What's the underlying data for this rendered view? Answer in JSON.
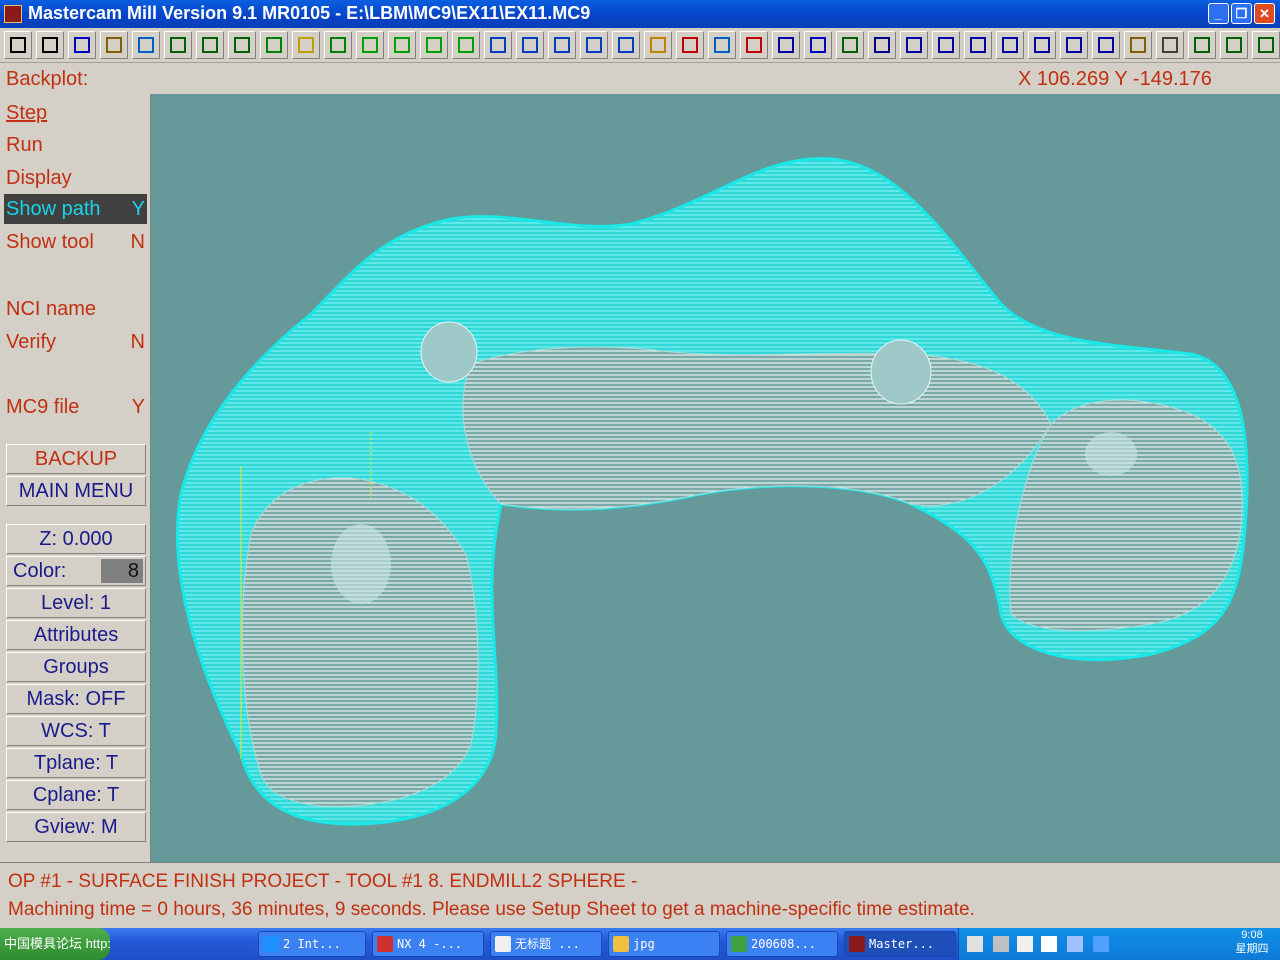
{
  "window": {
    "title": "Mastercam Mill Version 9.1 MR0105 - E:\\LBM\\MC9\\EX11\\EX11.MC9",
    "controls": {
      "minimize": "_",
      "maximize": "❐",
      "close": "✕"
    }
  },
  "toolbar": {
    "buttons": [
      "back-arrow",
      "forward-arrow",
      "help",
      "calculator",
      "pointer-zoom",
      "zoom",
      "unzoom",
      "zoom-window",
      "pan",
      "select-window",
      "rotate",
      "view-iso",
      "view-top",
      "view-front",
      "view-side",
      "view-back",
      "cube-wire",
      "cube-shade-1",
      "cube-shade-2",
      "cube-shade-3",
      "eraser",
      "no-symbol",
      "transform-1",
      "transform-2",
      "undo",
      "sphere",
      "chain",
      "sigma",
      "line",
      "arc",
      "trim",
      "spline",
      "rectangle",
      "plus",
      "plane",
      "solid-box",
      "layer-stack",
      "axis-x",
      "axis-y",
      "axis-z",
      "axis-xyz"
    ]
  },
  "statusline": {
    "mode": "Backplot:",
    "coords": "X 106.269  Y -149.176"
  },
  "menu": {
    "items": [
      {
        "label": "Step",
        "value": ""
      },
      {
        "label": "Run",
        "value": ""
      },
      {
        "label": "Display",
        "value": ""
      },
      {
        "label": "Show path",
        "value": "Y"
      },
      {
        "label": "Show tool",
        "value": "N"
      },
      {
        "label": "NCI name",
        "value": ""
      },
      {
        "label": "Verify",
        "value": "N"
      },
      {
        "label": "MC9 file",
        "value": "Y"
      }
    ],
    "backup": "BACKUP",
    "main_menu": "MAIN MENU"
  },
  "settings": {
    "z": "Z:   0.000",
    "color_label": "Color:",
    "color_value": "8",
    "level": "Level:  1",
    "attributes": "Attributes",
    "groups": "Groups",
    "mask": "Mask:  OFF",
    "wcs": "WCS:   T",
    "tplane": "Tplane:  T",
    "cplane": "Cplane:  T",
    "gview": "Gview:   M"
  },
  "prompt": {
    "line1": "OP #1 - SURFACE FINISH PROJECT - TOOL #1 8. ENDMILL2 SPHERE -",
    "line2": "Machining time = 0 hours, 36 minutes, 9 seconds. Please use Setup Sheet to get a machine-specific time estimate."
  },
  "taskbar": {
    "start": "中国模具论坛 http://www.mouldbbs.com",
    "tasks": [
      "2 Int...",
      "NX 4 -...",
      "无标题 ...",
      "jpg",
      "200608...",
      "Master..."
    ],
    "clock_time": "9:08",
    "clock_day": "星期四"
  },
  "colors": {
    "toolpath": "#19e8e8",
    "viewport_bg": "#669999",
    "menu_text": "#c03010",
    "setting_text": "#1a1a8a"
  }
}
